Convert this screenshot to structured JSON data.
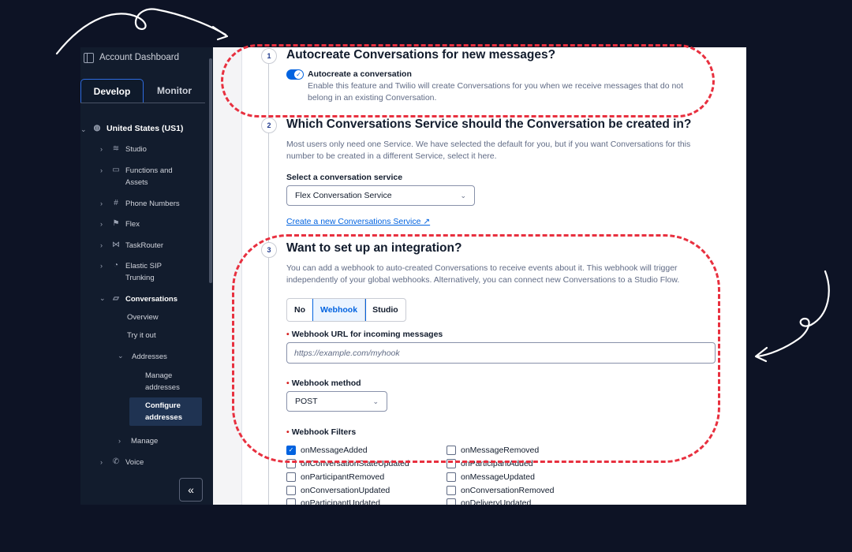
{
  "sidebar": {
    "account_dashboard": "Account Dashboard",
    "tabs": [
      "Develop",
      "Monitor"
    ],
    "region": "United States (US1)",
    "items": {
      "studio": "Studio",
      "functions_1": "Functions and",
      "functions_2": "Assets",
      "phone_numbers": "Phone Numbers",
      "flex": "Flex",
      "taskrouter": "TaskRouter",
      "elastic_1": "Elastic SIP",
      "elastic_2": "Trunking",
      "conversations": "Conversations",
      "overview": "Overview",
      "try_it_out": "Try it out",
      "addresses": "Addresses",
      "manage_addr_1": "Manage",
      "manage_addr_2": "addresses",
      "configure_1": "Configure",
      "configure_2": "addresses",
      "manage": "Manage",
      "voice": "Voice"
    },
    "collapse_glyph": "«"
  },
  "main": {
    "step1": {
      "num": "1",
      "title": "Autocreate Conversations for new messages?",
      "toggle_label": "Autocreate a conversation",
      "desc_1": "Enable this feature and Twilio will create Conversations for you when we receive messages that do not",
      "desc_2": "belong in an existing Conversation."
    },
    "step2": {
      "num": "2",
      "title": "Which Conversations Service should the Conversation be created in?",
      "desc_1": "Most users only need one Service. We have selected the default for you, but if you want Conversations for this",
      "desc_2": "number to be created in a different Service, select it here.",
      "select_label": "Select a conversation service",
      "select_value": "Flex Conversation Service",
      "create_link": "Create a new Conversations Service ↗"
    },
    "step3": {
      "num": "3",
      "title": "Want to set up an integration?",
      "desc_1": "You can add a webhook to auto-created Conversations to receive events about it. This webhook will trigger",
      "desc_2": "independently of your global webhooks. Alternatively, you can connect new Conversations to a Studio Flow.",
      "options": [
        "No",
        "Webhook",
        "Studio"
      ],
      "selected_option": "Webhook",
      "url_label": "Webhook URL for incoming messages",
      "url_placeholder": "https://example.com/myhook",
      "method_label": "Webhook method",
      "method_value": "POST",
      "filters_label": "Webhook Filters",
      "filters_left": [
        "onMessageAdded",
        "onConversationStateUpdated",
        "onParticipantRemoved",
        "onConversationUpdated",
        "onParticipantUpdated"
      ],
      "filters_right": [
        "onMessageRemoved",
        "onParticipantAdded",
        "onMessageUpdated",
        "onConversationRemoved",
        "onDeliveryUpdated"
      ],
      "checked": [
        "onMessageAdded"
      ]
    }
  },
  "colors": {
    "highlight": "#e8303f",
    "accent": "#0263e0",
    "sidebar": "#121c2d",
    "backdrop": "#0d1325"
  }
}
